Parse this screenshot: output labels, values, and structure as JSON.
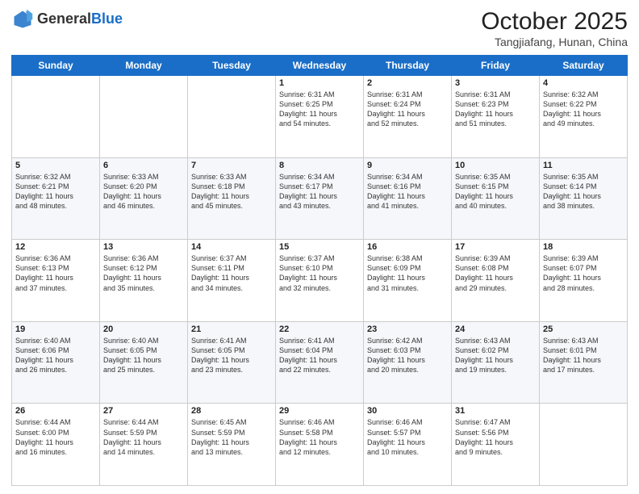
{
  "header": {
    "logo": {
      "general": "General",
      "blue": "Blue"
    },
    "title": "October 2025",
    "location": "Tangjiafang, Hunan, China"
  },
  "days_of_week": [
    "Sunday",
    "Monday",
    "Tuesday",
    "Wednesday",
    "Thursday",
    "Friday",
    "Saturday"
  ],
  "weeks": [
    [
      {
        "day": "",
        "lines": []
      },
      {
        "day": "",
        "lines": []
      },
      {
        "day": "",
        "lines": []
      },
      {
        "day": "1",
        "lines": [
          "Sunrise: 6:31 AM",
          "Sunset: 6:25 PM",
          "Daylight: 11 hours",
          "and 54 minutes."
        ]
      },
      {
        "day": "2",
        "lines": [
          "Sunrise: 6:31 AM",
          "Sunset: 6:24 PM",
          "Daylight: 11 hours",
          "and 52 minutes."
        ]
      },
      {
        "day": "3",
        "lines": [
          "Sunrise: 6:31 AM",
          "Sunset: 6:23 PM",
          "Daylight: 11 hours",
          "and 51 minutes."
        ]
      },
      {
        "day": "4",
        "lines": [
          "Sunrise: 6:32 AM",
          "Sunset: 6:22 PM",
          "Daylight: 11 hours",
          "and 49 minutes."
        ]
      }
    ],
    [
      {
        "day": "5",
        "lines": [
          "Sunrise: 6:32 AM",
          "Sunset: 6:21 PM",
          "Daylight: 11 hours",
          "and 48 minutes."
        ]
      },
      {
        "day": "6",
        "lines": [
          "Sunrise: 6:33 AM",
          "Sunset: 6:20 PM",
          "Daylight: 11 hours",
          "and 46 minutes."
        ]
      },
      {
        "day": "7",
        "lines": [
          "Sunrise: 6:33 AM",
          "Sunset: 6:18 PM",
          "Daylight: 11 hours",
          "and 45 minutes."
        ]
      },
      {
        "day": "8",
        "lines": [
          "Sunrise: 6:34 AM",
          "Sunset: 6:17 PM",
          "Daylight: 11 hours",
          "and 43 minutes."
        ]
      },
      {
        "day": "9",
        "lines": [
          "Sunrise: 6:34 AM",
          "Sunset: 6:16 PM",
          "Daylight: 11 hours",
          "and 41 minutes."
        ]
      },
      {
        "day": "10",
        "lines": [
          "Sunrise: 6:35 AM",
          "Sunset: 6:15 PM",
          "Daylight: 11 hours",
          "and 40 minutes."
        ]
      },
      {
        "day": "11",
        "lines": [
          "Sunrise: 6:35 AM",
          "Sunset: 6:14 PM",
          "Daylight: 11 hours",
          "and 38 minutes."
        ]
      }
    ],
    [
      {
        "day": "12",
        "lines": [
          "Sunrise: 6:36 AM",
          "Sunset: 6:13 PM",
          "Daylight: 11 hours",
          "and 37 minutes."
        ]
      },
      {
        "day": "13",
        "lines": [
          "Sunrise: 6:36 AM",
          "Sunset: 6:12 PM",
          "Daylight: 11 hours",
          "and 35 minutes."
        ]
      },
      {
        "day": "14",
        "lines": [
          "Sunrise: 6:37 AM",
          "Sunset: 6:11 PM",
          "Daylight: 11 hours",
          "and 34 minutes."
        ]
      },
      {
        "day": "15",
        "lines": [
          "Sunrise: 6:37 AM",
          "Sunset: 6:10 PM",
          "Daylight: 11 hours",
          "and 32 minutes."
        ]
      },
      {
        "day": "16",
        "lines": [
          "Sunrise: 6:38 AM",
          "Sunset: 6:09 PM",
          "Daylight: 11 hours",
          "and 31 minutes."
        ]
      },
      {
        "day": "17",
        "lines": [
          "Sunrise: 6:39 AM",
          "Sunset: 6:08 PM",
          "Daylight: 11 hours",
          "and 29 minutes."
        ]
      },
      {
        "day": "18",
        "lines": [
          "Sunrise: 6:39 AM",
          "Sunset: 6:07 PM",
          "Daylight: 11 hours",
          "and 28 minutes."
        ]
      }
    ],
    [
      {
        "day": "19",
        "lines": [
          "Sunrise: 6:40 AM",
          "Sunset: 6:06 PM",
          "Daylight: 11 hours",
          "and 26 minutes."
        ]
      },
      {
        "day": "20",
        "lines": [
          "Sunrise: 6:40 AM",
          "Sunset: 6:05 PM",
          "Daylight: 11 hours",
          "and 25 minutes."
        ]
      },
      {
        "day": "21",
        "lines": [
          "Sunrise: 6:41 AM",
          "Sunset: 6:05 PM",
          "Daylight: 11 hours",
          "and 23 minutes."
        ]
      },
      {
        "day": "22",
        "lines": [
          "Sunrise: 6:41 AM",
          "Sunset: 6:04 PM",
          "Daylight: 11 hours",
          "and 22 minutes."
        ]
      },
      {
        "day": "23",
        "lines": [
          "Sunrise: 6:42 AM",
          "Sunset: 6:03 PM",
          "Daylight: 11 hours",
          "and 20 minutes."
        ]
      },
      {
        "day": "24",
        "lines": [
          "Sunrise: 6:43 AM",
          "Sunset: 6:02 PM",
          "Daylight: 11 hours",
          "and 19 minutes."
        ]
      },
      {
        "day": "25",
        "lines": [
          "Sunrise: 6:43 AM",
          "Sunset: 6:01 PM",
          "Daylight: 11 hours",
          "and 17 minutes."
        ]
      }
    ],
    [
      {
        "day": "26",
        "lines": [
          "Sunrise: 6:44 AM",
          "Sunset: 6:00 PM",
          "Daylight: 11 hours",
          "and 16 minutes."
        ]
      },
      {
        "day": "27",
        "lines": [
          "Sunrise: 6:44 AM",
          "Sunset: 5:59 PM",
          "Daylight: 11 hours",
          "and 14 minutes."
        ]
      },
      {
        "day": "28",
        "lines": [
          "Sunrise: 6:45 AM",
          "Sunset: 5:59 PM",
          "Daylight: 11 hours",
          "and 13 minutes."
        ]
      },
      {
        "day": "29",
        "lines": [
          "Sunrise: 6:46 AM",
          "Sunset: 5:58 PM",
          "Daylight: 11 hours",
          "and 12 minutes."
        ]
      },
      {
        "day": "30",
        "lines": [
          "Sunrise: 6:46 AM",
          "Sunset: 5:57 PM",
          "Daylight: 11 hours",
          "and 10 minutes."
        ]
      },
      {
        "day": "31",
        "lines": [
          "Sunrise: 6:47 AM",
          "Sunset: 5:56 PM",
          "Daylight: 11 hours",
          "and 9 minutes."
        ]
      },
      {
        "day": "",
        "lines": []
      }
    ]
  ]
}
